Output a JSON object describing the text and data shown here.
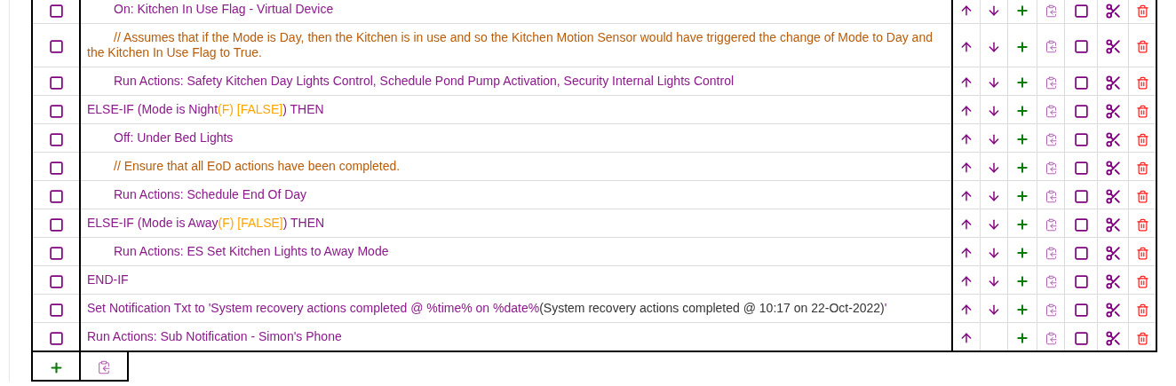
{
  "rows": [
    {
      "children": [
        {
          "checked": false,
          "mark_checked": false,
          "can_move_down": true,
          "segments": [
            {
              "kind": "statement",
              "text": "On: Kitchen In Use Flag - Virtual Device"
            }
          ]
        },
        {
          "checked": false,
          "mark_checked": false,
          "can_move_down": true,
          "segments": [
            {
              "kind": "comment",
              "text": "// Assumes that if the Mode is Day, then the Kitchen is in use and so the Kitchen Motion Sensor would have triggered the change of Mode to Day and the Kitchen In Use Flag to True."
            }
          ]
        },
        {
          "checked": false,
          "mark_checked": false,
          "can_move_down": true,
          "segments": [
            {
              "kind": "statement",
              "text": "Run Actions: Safety Kitchen Day Lights Control, Schedule Pond Pump Activation, Security Internal Lights Control"
            }
          ]
        }
      ]
    },
    {
      "checked": false,
      "mark_checked": false,
      "can_move_down": true,
      "segments": [
        {
          "kind": "statement",
          "text": "ELSE-IF (Mode is Night"
        },
        {
          "kind": "evaluation",
          "text": "(F) [FALSE]"
        },
        {
          "kind": "statement",
          "text": ") THEN"
        }
      ],
      "children": [
        {
          "checked": false,
          "mark_checked": false,
          "can_move_down": true,
          "segments": [
            {
              "kind": "statement",
              "text": "Off: Under Bed Lights"
            }
          ]
        },
        {
          "checked": false,
          "mark_checked": false,
          "can_move_down": true,
          "segments": [
            {
              "kind": "comment",
              "text": "// Ensure that all EoD actions have been completed."
            }
          ]
        },
        {
          "checked": false,
          "mark_checked": false,
          "can_move_down": true,
          "segments": [
            {
              "kind": "statement",
              "text": "Run Actions: Schedule End Of Day"
            }
          ]
        }
      ]
    },
    {
      "checked": false,
      "mark_checked": false,
      "can_move_down": true,
      "segments": [
        {
          "kind": "statement",
          "text": "ELSE-IF (Mode is Away"
        },
        {
          "kind": "evaluation",
          "text": "(F) [FALSE]"
        },
        {
          "kind": "statement",
          "text": ") THEN"
        }
      ],
      "children": [
        {
          "checked": false,
          "mark_checked": false,
          "can_move_down": true,
          "segments": [
            {
              "kind": "statement",
              "text": "Run Actions: ES Set Kitchen Lights to Away Mode"
            }
          ]
        }
      ]
    },
    {
      "checked": false,
      "mark_checked": false,
      "can_move_down": true,
      "segments": [
        {
          "kind": "statement",
          "text": "END-IF"
        }
      ]
    },
    {
      "checked": false,
      "mark_checked": false,
      "can_move_down": true,
      "segments": [
        {
          "kind": "statement",
          "text": "Set Notification Txt to 'System recovery actions completed @ %time% on %date%"
        },
        {
          "kind": "result",
          "text": "(System recovery actions completed @ 10:17 on 22-Oct-2022)"
        },
        {
          "kind": "statement",
          "text": "'"
        }
      ]
    },
    {
      "checked": false,
      "mark_checked": false,
      "can_move_down": false,
      "segments": [
        {
          "kind": "statement",
          "text": "Run Actions: Sub Notification - Simon's Phone"
        }
      ]
    }
  ]
}
